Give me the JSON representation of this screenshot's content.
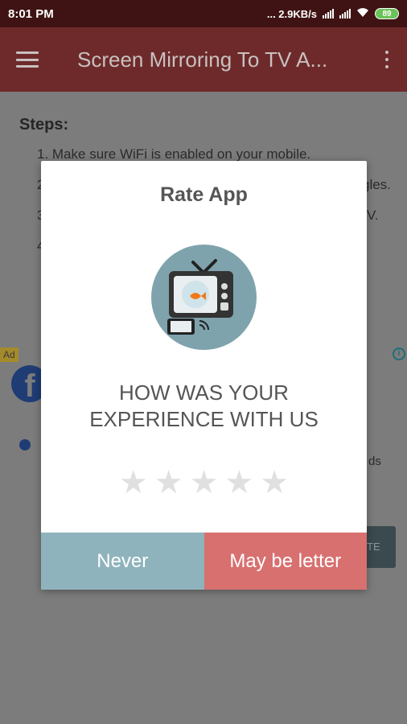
{
  "status_bar": {
    "time": "8:01 PM",
    "speed": "... 2.9KB/s",
    "battery": "89"
  },
  "app_bar": {
    "title": "Screen Mirroring To TV A..."
  },
  "background": {
    "steps_heading": "Steps:",
    "step_1": "1. Make sure WiFi is enabled on your mobile.",
    "step_2_tail": "gles.",
    "step_3_tail": "V.",
    "ad_label": "Ad",
    "ads_fragment": "ds",
    "button_fragment": "TE"
  },
  "dialog": {
    "title": "Rate App",
    "question_line1": "HOW WAS YOUR",
    "question_line2": "EXPERIENCE WITH US",
    "star_glyph": "★",
    "rating": 0,
    "rating_max": 5,
    "never_label": "Never",
    "later_label": "May be letter"
  },
  "colors": {
    "status_bar": "#3f1313",
    "app_bar": "#6e2a2a",
    "never_button": "#8fb3bc",
    "later_button": "#d87070",
    "star_empty": "#e0e0e0",
    "icon_circle": "#7fa3ad"
  },
  "icons": {
    "menu": "hamburger-icon",
    "more": "more-vert-icon",
    "app": "tv-mirroring-app-icon"
  }
}
